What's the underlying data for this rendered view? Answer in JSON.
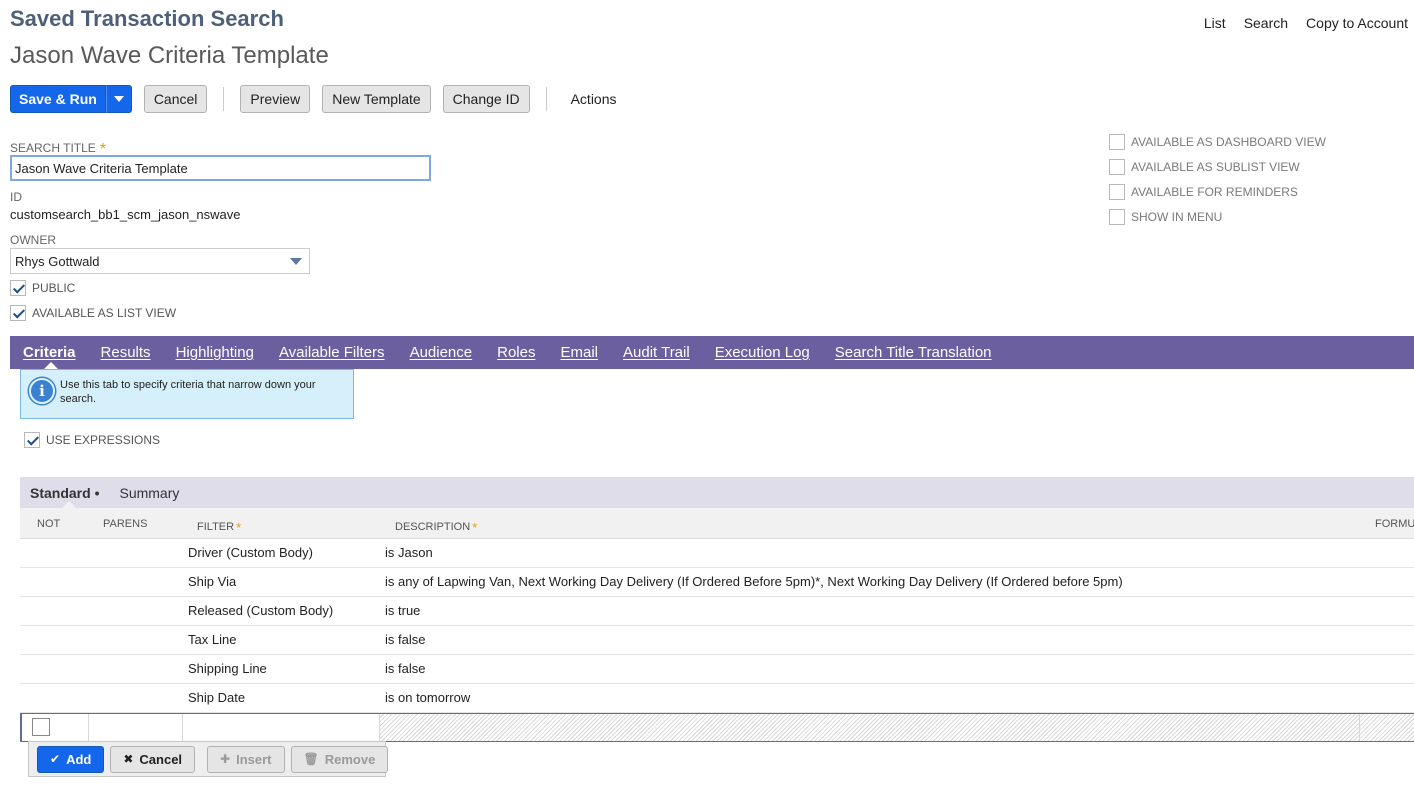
{
  "header": {
    "page_title": "Saved Transaction Search",
    "record_title": "Jason Wave Criteria Template",
    "links": [
      "List",
      "Search",
      "Copy to Account"
    ]
  },
  "toolbar": {
    "save_run": "Save & Run",
    "cancel": "Cancel",
    "preview": "Preview",
    "new_template": "New Template",
    "change_id": "Change ID",
    "actions": "Actions"
  },
  "form": {
    "search_title_label": "Search Title",
    "search_title_value": "Jason Wave Criteria Template",
    "id_label": "ID",
    "id_value": "customsearch_bb1_scm_jason_nswave",
    "owner_label": "Owner",
    "owner_value": "Rhys Gottwald",
    "public_label": "Public",
    "list_view_label": "Available as List View"
  },
  "right_options": {
    "dashboard": "Available as Dashboard View",
    "sublist": "Available as Sublist View",
    "reminders": "Available for Reminders",
    "show_menu": "Show in Menu"
  },
  "tabs": [
    "Criteria",
    "Results",
    "Highlighting",
    "Available Filters",
    "Audience",
    "Roles",
    "Email",
    "Audit Trail",
    "Execution Log",
    "Search Title Translation"
  ],
  "criteria": {
    "info_text": "Use this tab to specify criteria that narrow down your search.",
    "use_expressions_label": "Use Expressions",
    "subtabs": {
      "standard": "Standard",
      "summary": "Summary"
    },
    "columns": {
      "not": "Not",
      "parens": "Parens",
      "filter": "Filter",
      "description": "Description",
      "formula": "Formu"
    },
    "rows": [
      {
        "filter": "Driver (Custom Body)",
        "description": "is Jason"
      },
      {
        "filter": "Ship Via",
        "description": "is any of Lapwing Van, Next Working Day Delivery (If Ordered Before 5pm)*, Next Working Day Delivery (If Ordered before 5pm)"
      },
      {
        "filter": "Released (Custom Body)",
        "description": "is true"
      },
      {
        "filter": "Tax Line",
        "description": "is false"
      },
      {
        "filter": "Shipping Line",
        "description": "is false"
      },
      {
        "filter": "Ship Date",
        "description": "is on tomorrow"
      }
    ],
    "buttons": {
      "add": "Add",
      "cancel": "Cancel",
      "insert": "Insert",
      "remove": "Remove"
    }
  }
}
